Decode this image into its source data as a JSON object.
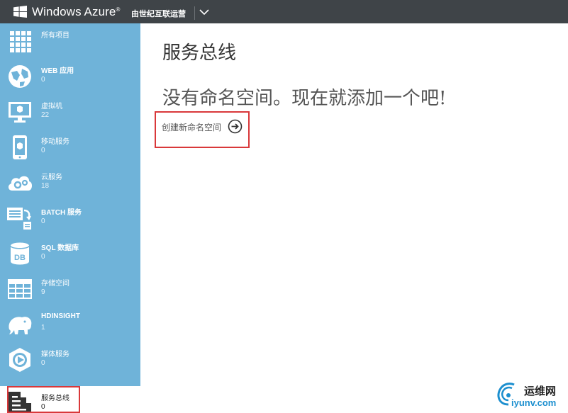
{
  "topbar": {
    "brand": "Windows Azure",
    "brand_mark": "®",
    "operator": "由世纪互联运营"
  },
  "sidebar": {
    "items": [
      {
        "label": "所有项目",
        "count": ""
      },
      {
        "label": "WEB 应用",
        "count": "0"
      },
      {
        "label": "虚拟机",
        "count": "22"
      },
      {
        "label": "移动服务",
        "count": "0"
      },
      {
        "label": "云服务",
        "count": "18"
      },
      {
        "label": "BATCH 服务",
        "count": "0"
      },
      {
        "label": "SQL 数据库",
        "count": "0"
      },
      {
        "label": "存储空间",
        "count": "9"
      },
      {
        "label": "HDINSIGHT",
        "count": "1"
      },
      {
        "label": "媒体服务",
        "count": "0"
      },
      {
        "label": "服务总线",
        "count": "0"
      }
    ],
    "db_icon_text": "DB"
  },
  "main": {
    "title": "服务总线",
    "empty_message": "没有命名空间。现在就添加一个吧!",
    "create_label": "创建新命名空间"
  },
  "watermark": {
    "cn": "运维网",
    "url": "iyunv.com"
  },
  "colors": {
    "topbar": "#3f4448",
    "sidebar": "#6fb3d9",
    "highlight": "#d9383a",
    "watermark_blue": "#1c8fcf"
  }
}
